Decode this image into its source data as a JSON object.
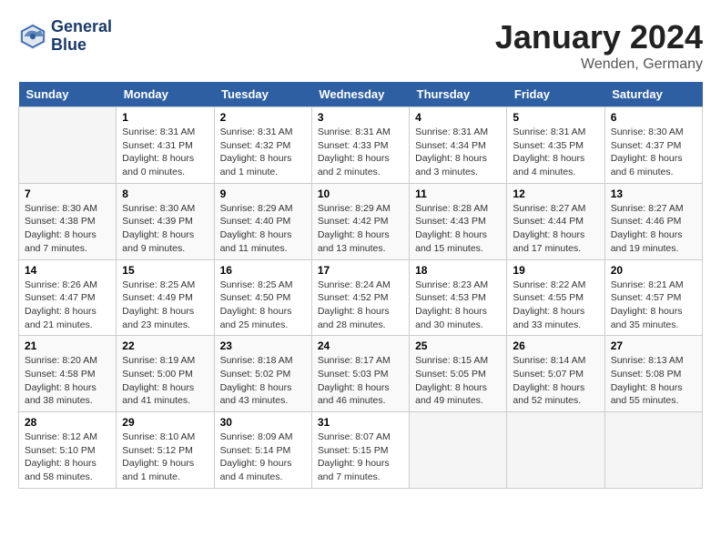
{
  "header": {
    "logo_line1": "General",
    "logo_line2": "Blue",
    "month_title": "January 2024",
    "location": "Wenden, Germany"
  },
  "weekdays": [
    "Sunday",
    "Monday",
    "Tuesday",
    "Wednesday",
    "Thursday",
    "Friday",
    "Saturday"
  ],
  "weeks": [
    [
      {
        "day": "",
        "sunrise": "",
        "sunset": "",
        "daylight": ""
      },
      {
        "day": "1",
        "sunrise": "Sunrise: 8:31 AM",
        "sunset": "Sunset: 4:31 PM",
        "daylight": "Daylight: 8 hours and 0 minutes."
      },
      {
        "day": "2",
        "sunrise": "Sunrise: 8:31 AM",
        "sunset": "Sunset: 4:32 PM",
        "daylight": "Daylight: 8 hours and 1 minute."
      },
      {
        "day": "3",
        "sunrise": "Sunrise: 8:31 AM",
        "sunset": "Sunset: 4:33 PM",
        "daylight": "Daylight: 8 hours and 2 minutes."
      },
      {
        "day": "4",
        "sunrise": "Sunrise: 8:31 AM",
        "sunset": "Sunset: 4:34 PM",
        "daylight": "Daylight: 8 hours and 3 minutes."
      },
      {
        "day": "5",
        "sunrise": "Sunrise: 8:31 AM",
        "sunset": "Sunset: 4:35 PM",
        "daylight": "Daylight: 8 hours and 4 minutes."
      },
      {
        "day": "6",
        "sunrise": "Sunrise: 8:30 AM",
        "sunset": "Sunset: 4:37 PM",
        "daylight": "Daylight: 8 hours and 6 minutes."
      }
    ],
    [
      {
        "day": "7",
        "sunrise": "Sunrise: 8:30 AM",
        "sunset": "Sunset: 4:38 PM",
        "daylight": "Daylight: 8 hours and 7 minutes."
      },
      {
        "day": "8",
        "sunrise": "Sunrise: 8:30 AM",
        "sunset": "Sunset: 4:39 PM",
        "daylight": "Daylight: 8 hours and 9 minutes."
      },
      {
        "day": "9",
        "sunrise": "Sunrise: 8:29 AM",
        "sunset": "Sunset: 4:40 PM",
        "daylight": "Daylight: 8 hours and 11 minutes."
      },
      {
        "day": "10",
        "sunrise": "Sunrise: 8:29 AM",
        "sunset": "Sunset: 4:42 PM",
        "daylight": "Daylight: 8 hours and 13 minutes."
      },
      {
        "day": "11",
        "sunrise": "Sunrise: 8:28 AM",
        "sunset": "Sunset: 4:43 PM",
        "daylight": "Daylight: 8 hours and 15 minutes."
      },
      {
        "day": "12",
        "sunrise": "Sunrise: 8:27 AM",
        "sunset": "Sunset: 4:44 PM",
        "daylight": "Daylight: 8 hours and 17 minutes."
      },
      {
        "day": "13",
        "sunrise": "Sunrise: 8:27 AM",
        "sunset": "Sunset: 4:46 PM",
        "daylight": "Daylight: 8 hours and 19 minutes."
      }
    ],
    [
      {
        "day": "14",
        "sunrise": "Sunrise: 8:26 AM",
        "sunset": "Sunset: 4:47 PM",
        "daylight": "Daylight: 8 hours and 21 minutes."
      },
      {
        "day": "15",
        "sunrise": "Sunrise: 8:25 AM",
        "sunset": "Sunset: 4:49 PM",
        "daylight": "Daylight: 8 hours and 23 minutes."
      },
      {
        "day": "16",
        "sunrise": "Sunrise: 8:25 AM",
        "sunset": "Sunset: 4:50 PM",
        "daylight": "Daylight: 8 hours and 25 minutes."
      },
      {
        "day": "17",
        "sunrise": "Sunrise: 8:24 AM",
        "sunset": "Sunset: 4:52 PM",
        "daylight": "Daylight: 8 hours and 28 minutes."
      },
      {
        "day": "18",
        "sunrise": "Sunrise: 8:23 AM",
        "sunset": "Sunset: 4:53 PM",
        "daylight": "Daylight: 8 hours and 30 minutes."
      },
      {
        "day": "19",
        "sunrise": "Sunrise: 8:22 AM",
        "sunset": "Sunset: 4:55 PM",
        "daylight": "Daylight: 8 hours and 33 minutes."
      },
      {
        "day": "20",
        "sunrise": "Sunrise: 8:21 AM",
        "sunset": "Sunset: 4:57 PM",
        "daylight": "Daylight: 8 hours and 35 minutes."
      }
    ],
    [
      {
        "day": "21",
        "sunrise": "Sunrise: 8:20 AM",
        "sunset": "Sunset: 4:58 PM",
        "daylight": "Daylight: 8 hours and 38 minutes."
      },
      {
        "day": "22",
        "sunrise": "Sunrise: 8:19 AM",
        "sunset": "Sunset: 5:00 PM",
        "daylight": "Daylight: 8 hours and 41 minutes."
      },
      {
        "day": "23",
        "sunrise": "Sunrise: 8:18 AM",
        "sunset": "Sunset: 5:02 PM",
        "daylight": "Daylight: 8 hours and 43 minutes."
      },
      {
        "day": "24",
        "sunrise": "Sunrise: 8:17 AM",
        "sunset": "Sunset: 5:03 PM",
        "daylight": "Daylight: 8 hours and 46 minutes."
      },
      {
        "day": "25",
        "sunrise": "Sunrise: 8:15 AM",
        "sunset": "Sunset: 5:05 PM",
        "daylight": "Daylight: 8 hours and 49 minutes."
      },
      {
        "day": "26",
        "sunrise": "Sunrise: 8:14 AM",
        "sunset": "Sunset: 5:07 PM",
        "daylight": "Daylight: 8 hours and 52 minutes."
      },
      {
        "day": "27",
        "sunrise": "Sunrise: 8:13 AM",
        "sunset": "Sunset: 5:08 PM",
        "daylight": "Daylight: 8 hours and 55 minutes."
      }
    ],
    [
      {
        "day": "28",
        "sunrise": "Sunrise: 8:12 AM",
        "sunset": "Sunset: 5:10 PM",
        "daylight": "Daylight: 8 hours and 58 minutes."
      },
      {
        "day": "29",
        "sunrise": "Sunrise: 8:10 AM",
        "sunset": "Sunset: 5:12 PM",
        "daylight": "Daylight: 9 hours and 1 minute."
      },
      {
        "day": "30",
        "sunrise": "Sunrise: 8:09 AM",
        "sunset": "Sunset: 5:14 PM",
        "daylight": "Daylight: 9 hours and 4 minutes."
      },
      {
        "day": "31",
        "sunrise": "Sunrise: 8:07 AM",
        "sunset": "Sunset: 5:15 PM",
        "daylight": "Daylight: 9 hours and 7 minutes."
      },
      {
        "day": "",
        "sunrise": "",
        "sunset": "",
        "daylight": ""
      },
      {
        "day": "",
        "sunrise": "",
        "sunset": "",
        "daylight": ""
      },
      {
        "day": "",
        "sunrise": "",
        "sunset": "",
        "daylight": ""
      }
    ]
  ]
}
